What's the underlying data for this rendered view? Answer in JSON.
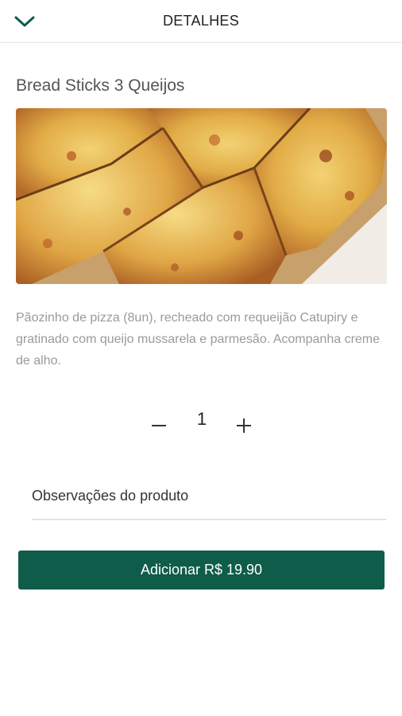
{
  "header": {
    "title": "DETALHES",
    "back_icon": "chevron-down-icon"
  },
  "product": {
    "name": "Bread Sticks 3 Queijos",
    "description": "Pãozinho de pizza (8un), recheado com requeijão Catupiry e gratinado com queijo mussarela e parmesão. Acompanha creme de alho."
  },
  "quantity": {
    "value": "1",
    "minus_icon": "minus-icon",
    "plus_icon": "plus-icon"
  },
  "notes": {
    "placeholder": "Observações do produto"
  },
  "action": {
    "add_label": "Adicionar R$ 19.90"
  },
  "colors": {
    "accent": "#0f5c4b",
    "chevron": "#0f5c4b"
  }
}
